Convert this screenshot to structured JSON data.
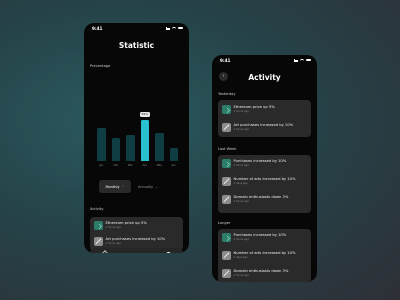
{
  "statistic": {
    "status_time": "9:41",
    "title": "Statistic",
    "percentage_label": "Precentage",
    "tooltip": "59%",
    "chart_data": {
      "type": "bar",
      "categories": [
        "Jan",
        "Feb",
        "Mar",
        "Apr",
        "May",
        "Jun"
      ],
      "values": [
        66,
        46,
        53,
        83,
        57,
        26
      ],
      "highlighted": "Apr",
      "ylim": [
        0,
        100
      ],
      "colors": {
        "bar": "#0e3d44",
        "highlight": "#28c2d1"
      }
    },
    "toggle": {
      "monthly": "Monthly",
      "annually": "Annually"
    },
    "activity_label": "Activity",
    "items": [
      {
        "title": "Ethereum price up 5%",
        "time": "2 hours ago",
        "icon": "trend-up-icon"
      },
      {
        "title": "Art purchases increased by 10%",
        "time": "2 hours ago",
        "icon": "art-icon"
      }
    ]
  },
  "activity": {
    "status_time": "9:41",
    "title": "Activity",
    "back_icon": "chevron-left-icon",
    "groups": [
      {
        "label": "Yesterday",
        "items": [
          {
            "title": "Ethereum price up 5%",
            "time": "2 hours ago",
            "icon": "trend-up-icon"
          },
          {
            "title": "Art purchases increased by 10%",
            "time": "2 hours ago",
            "icon": "art-icon"
          }
        ]
      },
      {
        "label": "Last Week",
        "items": [
          {
            "title": "Purchases increased by 10%",
            "time": "2 hours ago",
            "icon": "trend-up-icon"
          },
          {
            "title": "Number of arts increased by 10%",
            "time": "2 days ago",
            "icon": "art-icon"
          },
          {
            "title": "Domain enthusiasts down 3%",
            "time": "2 hours ago",
            "icon": "art-icon"
          }
        ]
      },
      {
        "label": "Longer",
        "items": [
          {
            "title": "Purchases increased by 10%",
            "time": "2 hours ago",
            "icon": "trend-up-icon"
          },
          {
            "title": "Number of arts increased by 10%",
            "time": "2 days ago",
            "icon": "art-icon"
          },
          {
            "title": "Domain enthusiasts down 3%",
            "time": "2 hours ago",
            "icon": "art-icon"
          }
        ]
      }
    ]
  }
}
